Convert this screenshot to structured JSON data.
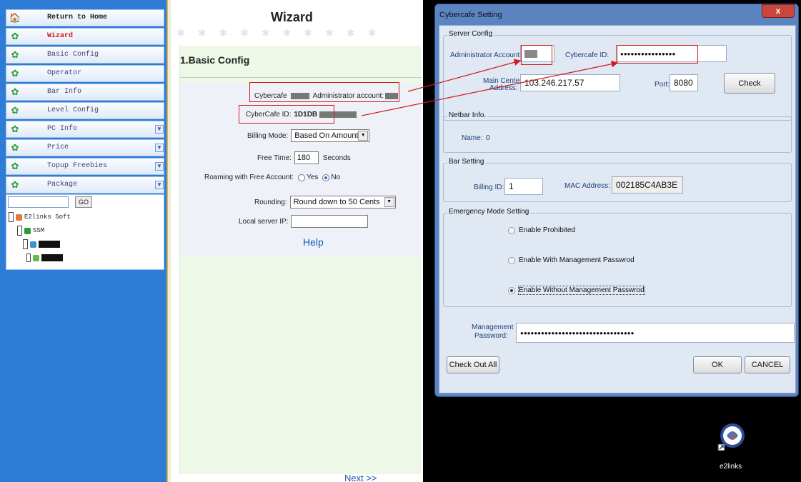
{
  "sidebar": {
    "items": [
      {
        "label": "Return to Home",
        "icon": "home-icon",
        "expand": false
      },
      {
        "label": "Wizard",
        "icon": "settings-icon",
        "expand": false
      },
      {
        "label": "Basic Config",
        "icon": "settings-icon",
        "expand": false
      },
      {
        "label": "Operator",
        "icon": "settings-icon",
        "expand": false
      },
      {
        "label": "Bar Info",
        "icon": "settings-icon",
        "expand": false
      },
      {
        "label": "Level Config",
        "icon": "settings-icon",
        "expand": false
      },
      {
        "label": "PC Info",
        "icon": "settings-icon",
        "expand": true
      },
      {
        "label": "Price",
        "icon": "settings-icon",
        "expand": true
      },
      {
        "label": "Topup Freebies",
        "icon": "settings-icon",
        "expand": true
      },
      {
        "label": "Package",
        "icon": "settings-icon",
        "expand": true
      }
    ],
    "search": {
      "value": "",
      "go_label": "GO"
    },
    "tree": {
      "root": "E2links Soft",
      "child": "SSM"
    }
  },
  "wizard": {
    "title": "Wizard",
    "section_title": "1.Basic Config",
    "cybercafe_label": "Cybercafe",
    "admin_label": "Administrator account:",
    "cybercafe_id_label": "CyberCafe ID:",
    "cybercafe_id_value": "1D1DB",
    "billing_mode_label": "Billing Mode:",
    "billing_mode_value": "Based On Amount",
    "free_time_label": "Free Time:",
    "free_time_value": "180",
    "free_time_unit": "Seconds",
    "roaming_label": "Roaming with Free Account:",
    "roaming_yes": "Yes",
    "roaming_no": "No",
    "rounding_label": "Rounding:",
    "rounding_value": "Round down to 50 Cents",
    "local_ip_label": "Local server IP:",
    "local_ip_value": "",
    "help_label": "Help",
    "next_label": "Next >>"
  },
  "dialog": {
    "title": "Cybercafe Setting",
    "close_label": "x",
    "server_config": {
      "title": "Server Config",
      "admin_label": "Administrator Account:",
      "cafe_id_label": "Cybercafe ID:",
      "cafe_id_value": "●●●●●●●●●●●●●●●●",
      "main_center_label_1": "Main Center",
      "main_center_label_2": "Address:",
      "main_center_value": "103.246.217.57",
      "port_label": "Port:",
      "port_value": "8080",
      "check_label": "Check"
    },
    "netbar": {
      "title": "Netbar Info.",
      "name_label": "Name:",
      "name_value": "0"
    },
    "bar_setting": {
      "title": "Bar Setting",
      "billing_id_label": "Billing ID:",
      "billing_id_value": "1",
      "mac_label": "MAC Address:",
      "mac_value": "002185C4AB3E"
    },
    "emergency": {
      "title": "Emergency Mode Setting",
      "options": [
        "Enable Prohibited",
        "Enable With Management Passwrod",
        "Enable Without Management Passwrod"
      ],
      "selected": 2
    },
    "mgmt_label_1": "Management",
    "mgmt_label_2": "Password:",
    "mgmt_value": "●●●●●●●●●●●●●●●●●●●●●●●●●●●●●●●●●",
    "checkout_label": "Check Out All",
    "ok_label": "OK",
    "cancel_label": "CANCEL"
  },
  "desktop": {
    "icon_label": "e2links"
  },
  "colors": {
    "sidebar_bg": "#2f7cd6",
    "dialog_frame": "#5b84c0",
    "annotation_red": "#d21a1a",
    "link_blue": "#1f57b8"
  }
}
